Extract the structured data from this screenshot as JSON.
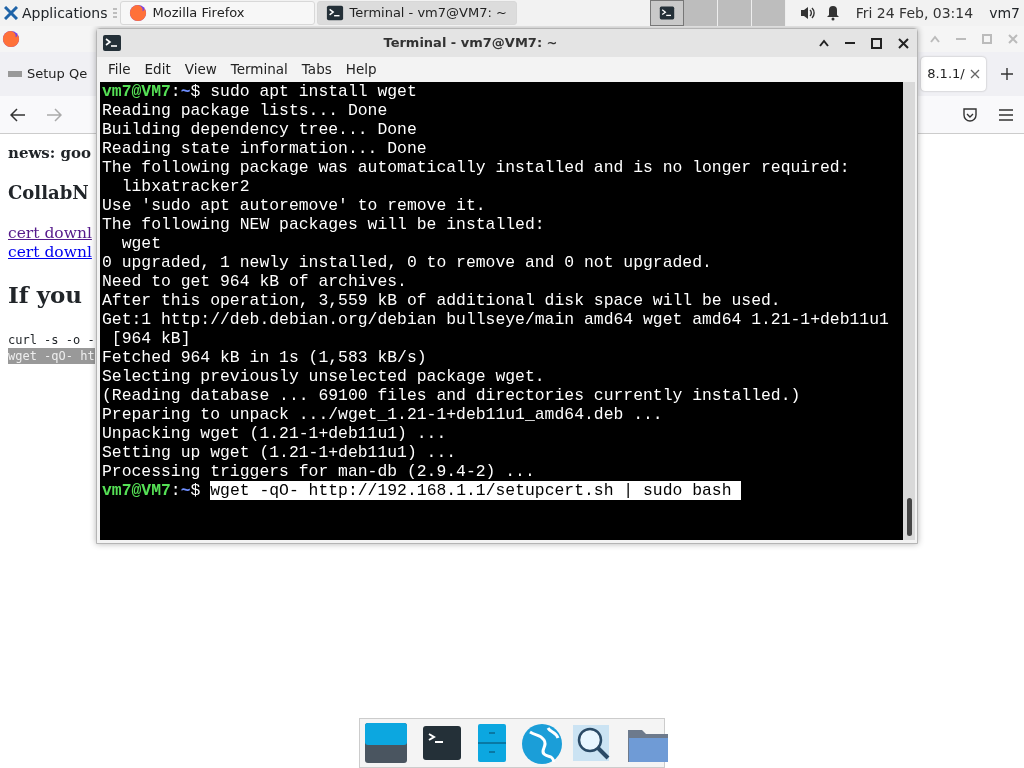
{
  "top_panel": {
    "applications_label": "Applications",
    "taskbar": [
      {
        "label": "Mozilla Firefox",
        "kind": "firefox",
        "selected": false
      },
      {
        "label": "Terminal - vm7@VM7: ~",
        "kind": "terminal",
        "selected": true
      }
    ],
    "workspaces": [
      {
        "selected": true
      },
      {
        "selected": false
      },
      {
        "selected": false
      },
      {
        "selected": false
      }
    ],
    "clock": "Fri 24 Feb, 03:14",
    "user": "vm7"
  },
  "browser": {
    "tabs": [
      {
        "label": "Setup Qe",
        "selected": false
      },
      {
        "label": "8.1.1/",
        "selected": true
      }
    ],
    "page": [
      {
        "kind": "h3",
        "text": "news: goo"
      },
      {
        "kind": "h2",
        "text": "CollabN"
      },
      {
        "kind": "link",
        "text": "cert downl",
        "visited": true
      },
      {
        "kind": "link",
        "text": "cert downl",
        "visited": false
      },
      {
        "kind": "h1",
        "text": "If you"
      },
      {
        "kind": "code",
        "text": "curl -s -o -",
        "highlighted": false
      },
      {
        "kind": "code",
        "text": "wget -qO- ht",
        "highlighted": true
      }
    ]
  },
  "terminal": {
    "title": "Terminal - vm7@VM7: ~",
    "menu": [
      "File",
      "Edit",
      "View",
      "Terminal",
      "Tabs",
      "Help"
    ],
    "lines": [
      {
        "kind": "prompt",
        "user": "vm7@VM7",
        "separator": ":",
        "path": "~",
        "symbol": "$",
        "command": "sudo apt install wget",
        "highlighted": false
      },
      {
        "kind": "output",
        "text": "Reading package lists... Done"
      },
      {
        "kind": "output",
        "text": "Building dependency tree... Done"
      },
      {
        "kind": "output",
        "text": "Reading state information... Done"
      },
      {
        "kind": "output",
        "text": "The following package was automatically installed and is no longer required:"
      },
      {
        "kind": "output",
        "text": "  libxatracker2"
      },
      {
        "kind": "output",
        "text": "Use 'sudo apt autoremove' to remove it."
      },
      {
        "kind": "output",
        "text": "The following NEW packages will be installed:"
      },
      {
        "kind": "output",
        "text": "  wget"
      },
      {
        "kind": "output",
        "text": "0 upgraded, 1 newly installed, 0 to remove and 0 not upgraded."
      },
      {
        "kind": "output",
        "text": "Need to get 964 kB of archives."
      },
      {
        "kind": "output",
        "text": "After this operation, 3,559 kB of additional disk space will be used."
      },
      {
        "kind": "output",
        "text": "Get:1 http://deb.debian.org/debian bullseye/main amd64 wget amd64 1.21-1+deb11u1"
      },
      {
        "kind": "output",
        "text": " [964 kB]"
      },
      {
        "kind": "output",
        "text": "Fetched 964 kB in 1s (1,583 kB/s)"
      },
      {
        "kind": "output",
        "text": "Selecting previously unselected package wget."
      },
      {
        "kind": "output",
        "text": "(Reading database ... 69100 files and directories currently installed.)"
      },
      {
        "kind": "output",
        "text": "Preparing to unpack .../wget_1.21-1+deb11u1_amd64.deb ..."
      },
      {
        "kind": "output",
        "text": "Unpacking wget (1.21-1+deb11u1) ..."
      },
      {
        "kind": "output",
        "text": "Setting up wget (1.21-1+deb11u1) ..."
      },
      {
        "kind": "output",
        "text": "Processing triggers for man-db (2.9.4-2) ..."
      },
      {
        "kind": "prompt",
        "user": "vm7@VM7",
        "separator": ":",
        "path": "~",
        "symbol": "$",
        "command": "wget -qO- http://192.168.1.1/setupcert.sh | sudo bash ",
        "highlighted": true
      }
    ]
  },
  "dock": [
    {
      "kind": "desktop"
    },
    {
      "kind": "terminal"
    },
    {
      "kind": "files"
    },
    {
      "kind": "web"
    },
    {
      "kind": "search"
    },
    {
      "kind": "folder"
    }
  ]
}
